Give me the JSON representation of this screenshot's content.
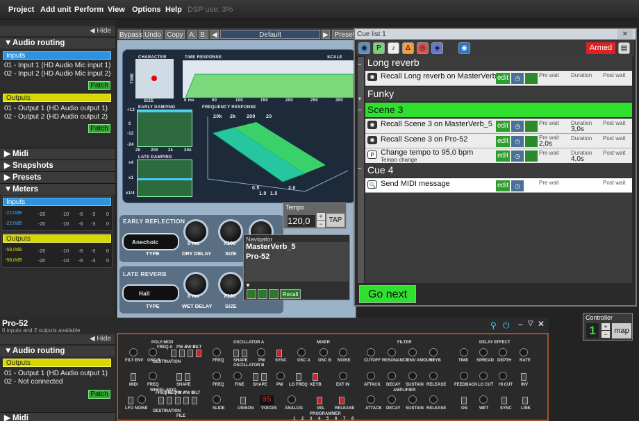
{
  "menu": [
    "Project",
    "Add unit",
    "Perform",
    "View",
    "Options",
    "Help"
  ],
  "dsp_use": "DSP use: 3%",
  "left_panel": {
    "hide": "◀ Hide",
    "audio_routing": "Audio routing",
    "inputs_label": "Inputs",
    "inputs": [
      "01 - Input 1 (HD Audio Mic input 1)",
      "02 - Input 2 (HD Audio Mic input 2)"
    ],
    "patch": "Patch",
    "outputs_label": "Outputs",
    "outputs": [
      "01 - Output 1 (HD Audio output 1)",
      "02 - Output 2 (HD Audio output 2)"
    ],
    "midi": "Midi",
    "snapshots": "Snapshots",
    "presets": "Presets",
    "meters": "Meters",
    "meter_inputs": "Inputs",
    "meter_outputs": "Outputs",
    "meter_in_db": "-22,0dB",
    "meter_out_db": "-58,0dB",
    "meter_ticks": [
      "-20",
      "-10",
      "-6",
      "-3",
      "0"
    ]
  },
  "plugin": {
    "toolbar": {
      "bypass": "Bypass",
      "undo": "Undo",
      "copy": "Copy",
      "a": "A:",
      "b": "B:",
      "preset_name": "Default",
      "preset": "Preset"
    },
    "character": "CHARACTER",
    "size": "SIZE",
    "time": "TIME",
    "time_response": "TIME RESPONSE",
    "scale": "SCALE",
    "time_axis": [
      "0 ms",
      "50",
      "100",
      "150",
      "200",
      "250",
      "300"
    ],
    "early_damping": "EARLY DAMPING",
    "late_damping": "LATE DAMPING",
    "frequency_response": "FREQUENCY RESPONSE",
    "freq_ticks": [
      "20k",
      "2k",
      "200",
      "20"
    ],
    "freq_x": [
      "0.5",
      "1.0",
      "1.5",
      "2.0"
    ],
    "damp_y1": [
      "+12",
      "0",
      "-12",
      "-24"
    ],
    "damp_x": [
      "20",
      "200",
      "2k",
      "20k"
    ],
    "damp_y2": [
      "x4",
      "x1",
      "x1/4"
    ],
    "early_reflection": "EARLY REFLECTION",
    "late_reverb": "LATE REVERB",
    "type_early": "Anechoic",
    "type_late": "Hall",
    "type": "TYPE",
    "dry_delay": "DRY DELAY",
    "wet_delay": "WET DELAY",
    "knob_size": "SIZE",
    "zero_ms": "0 ms",
    "x100": "X100"
  },
  "tempo": {
    "label": "Tempo",
    "value": "120,0",
    "tap": "TAP"
  },
  "navigator": {
    "label": "Navigator",
    "items": [
      "MasterVerb_5",
      "Pro-52"
    ],
    "recall": "Recall"
  },
  "cue_list": {
    "title": "Cue list 1",
    "armed": "Armed",
    "cues": [
      {
        "name": "Long reverb",
        "rows": [
          {
            "text": "Recall Long reverb on MasterVerb",
            "pre": "Pre wait",
            "dur": "Duration",
            "post": "Post wait"
          }
        ]
      },
      {
        "name": "Funky",
        "rows": []
      },
      {
        "name": "Scene 3",
        "rows": [
          {
            "text": "Recall Scene 3 on MasterVerb_5",
            "pre": "Pre wait",
            "dur": "Duration",
            "dur_val": "3,0s",
            "post": "Post wait"
          },
          {
            "text": "Recall Scene 3 on Pro-52",
            "pre": "Pre wait",
            "pre_val": "2,0s",
            "dur": "Duration",
            "post": "Post wait"
          },
          {
            "text": "Change tempo to 95,0 bpm",
            "sub": "Tempo change",
            "pre": "Pre wait",
            "dur": "Duration",
            "dur_val": "4,0s",
            "post": "Post wait"
          }
        ]
      },
      {
        "name": "Cue 4",
        "rows": [
          {
            "text": "Send MIDI message",
            "pre": "Pre wait",
            "post": "Post wait"
          }
        ]
      }
    ],
    "edit": "edit",
    "go_next": "Go next"
  },
  "pro52": {
    "title": "Pro-52",
    "subtitle": "0 inputs and 2 outputs available",
    "hide": "◀ Hide",
    "audio_routing": "Audio routing",
    "outputs_label": "Outputs",
    "outputs": [
      "01 - Output 1 (HD Audio output 1)",
      "02 - Not connected"
    ],
    "patch": "Patch",
    "midi": "Midi",
    "sections": [
      "POLY-MOD",
      "OSCILLATOR A",
      "MIXER",
      "FILTER",
      "DELAY EFFECT",
      "OSCILLATOR B",
      "WHEEL-MOD",
      "AMPLIFIER",
      "PROGRAMMER",
      "FILE",
      "DESTINATION",
      "LFO"
    ],
    "labels_row1": [
      "FILT ENV",
      "OSC B",
      "FREQ",
      "SHAPE",
      "PW",
      "SYNC",
      "OSC A",
      "OSC B",
      "NOISE",
      "CUTOFF",
      "RESONANCE",
      "ENV AMOUNT",
      "KEYB",
      "TIME",
      "SPREAD",
      "DEPTH",
      "RATE"
    ],
    "labels_row2": [
      "MIDI",
      "FREQ",
      "SHAPE",
      "FREQ",
      "FINE",
      "SHAPE",
      "PW",
      "LO FREQ",
      "KEYB",
      "EXT IN",
      "ATTACK",
      "DECAY",
      "SUSTAIN",
      "RELEASE",
      "FEEDBACK",
      "LO CUT",
      "HI CUT",
      "INV"
    ],
    "labels_row3": [
      "LFO",
      "NOISE",
      "FREQ A",
      "FREQ B",
      "PW A",
      "PW B",
      "FILT",
      "SLIDE",
      "UNISON",
      "VOICES",
      "ANALOG",
      "VEL",
      "RELEASE",
      "ATTACK",
      "DECAY",
      "SUSTAIN",
      "RELEASE",
      "ON",
      "WET",
      "SYNC",
      "LINK"
    ],
    "row1_prefix": [
      "FREQ A",
      "PW A",
      "PW B",
      "FILT"
    ],
    "voices": "05",
    "programmer_nums": [
      "1",
      "2",
      "3",
      "4",
      "5",
      "6",
      "7",
      "8"
    ]
  },
  "controller": {
    "label": "Controller",
    "value": "1",
    "map": "map"
  }
}
